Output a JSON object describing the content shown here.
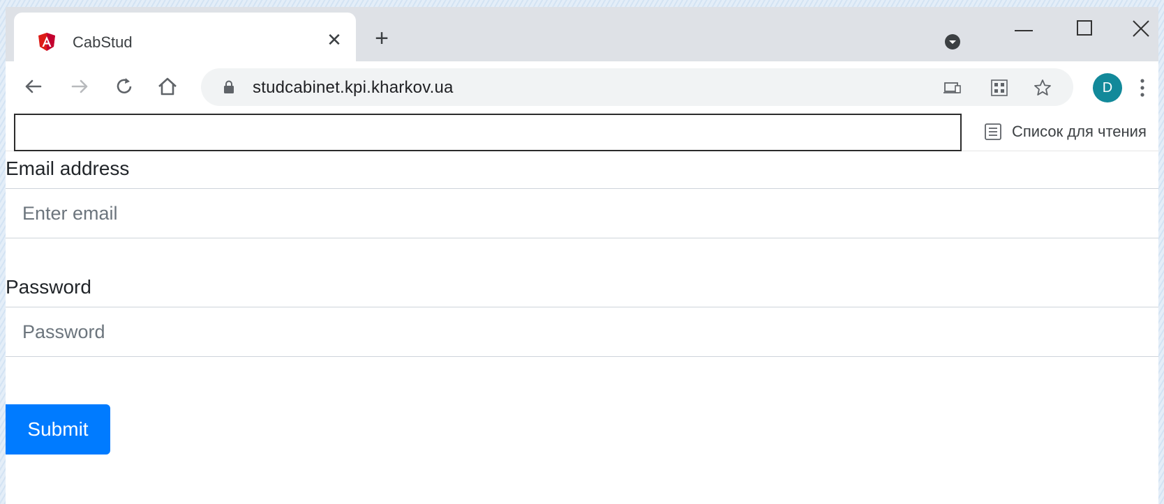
{
  "browser": {
    "tab": {
      "title": "CabStud",
      "favicon": "angular-logo",
      "close": "✕"
    },
    "new_tab": "+",
    "window_controls": [
      "minimize",
      "maximize",
      "close"
    ],
    "toolbar": {
      "url": "studcabinet.kpi.kharkov.ua",
      "profile_initial": "D",
      "icons": [
        "back-icon",
        "forward-icon",
        "reload-icon",
        "home-icon",
        "lock-icon",
        "install-app-icon",
        "qr-code-icon",
        "star-icon",
        "kebab-menu-icon"
      ]
    },
    "reading_list_label": "Список для чтения"
  },
  "form": {
    "email_label": "Email address",
    "email_placeholder": "Enter email",
    "email_value": "",
    "password_label": "Password",
    "password_placeholder": "Password",
    "password_value": "",
    "submit_label": "Submit"
  },
  "colors": {
    "primary": "#007bff",
    "avatar": "#12899a",
    "tabstrip": "#dee1e6"
  }
}
